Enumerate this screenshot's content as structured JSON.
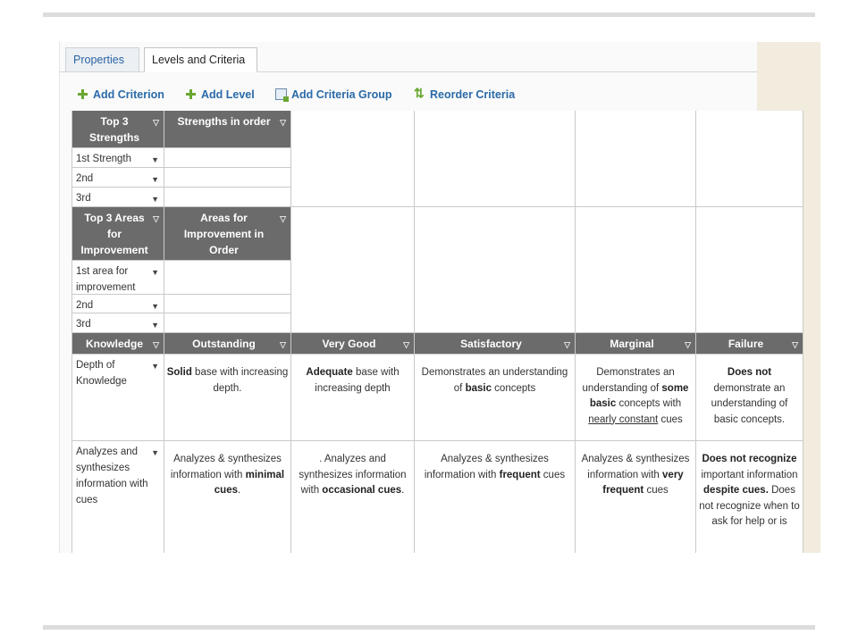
{
  "tabs": {
    "properties": "Properties",
    "levels": "Levels and Criteria"
  },
  "toolbar": {
    "add_criterion": "Add Criterion",
    "add_level": "Add Level",
    "add_group": "Add Criteria Group",
    "reorder": "Reorder Criteria"
  },
  "groups": {
    "strengths": {
      "header": "Top 3 Strengths",
      "level_header": "Strengths in order",
      "rows": [
        "1st Strength",
        "2nd",
        "3rd"
      ]
    },
    "improvement": {
      "header": "Top 3 Areas for Improvement",
      "level_header": "Areas for Improvement in Order",
      "rows": [
        "1st area for improvement",
        "2nd",
        "3rd"
      ]
    },
    "knowledge": {
      "header": "Knowledge",
      "levels": [
        "Outstanding",
        "Very Good",
        "Satisfactory",
        "Marginal",
        "Failure"
      ],
      "criteria": [
        {
          "name": "Depth of Knowledge",
          "cells": [
            "<b>Solid</b> base with increasing depth.",
            "<b>Adequate</b> base with increasing depth",
            "Demonstrates an understanding of <b>basic</b> concepts",
            "Demonstrates an understanding of <b>some basic</b> concepts with <u>nearly constant</u> cues",
            "<b>Does not</b> demonstrate an understanding of basic concepts."
          ]
        },
        {
          "name": "Analyzes and synthesizes information with cues",
          "cells": [
            "Analyzes &amp; synthesizes information with <b>minimal cues</b>.",
            ". Analyzes and synthesizes information with <b>occasional cues</b>.",
            "Analyzes &amp; synthesizes information with <b>frequent</b> cues",
            "Analyzes &amp; synthesizes information with <b>very frequent</b> cues",
            "<b>Does not recognize</b> important information <b>despite cues.</b> Does not recognize when to ask for help or is"
          ]
        }
      ]
    }
  },
  "colors": {
    "header_bg": "#6b6b6b",
    "link": "#2a6aa8",
    "icon_green": "#6aa732",
    "side_panel": "#f2ecde"
  }
}
